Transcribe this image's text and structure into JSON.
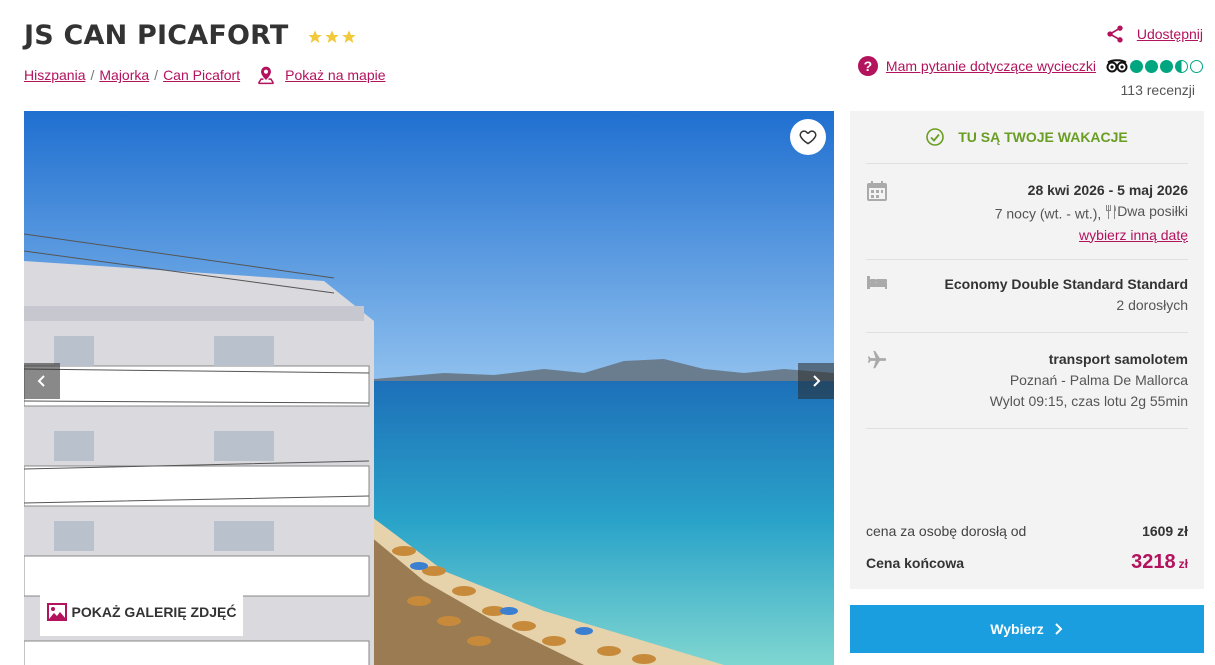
{
  "hotel": {
    "name": "JS CAN PICAFORT",
    "stars": 3
  },
  "breadcrumb": {
    "items": [
      "Hiszpania",
      "Majorka",
      "Can Picafort"
    ],
    "separator": "/",
    "map_link": "Pokaż na mapie"
  },
  "actions": {
    "share_label": "Udostępnij",
    "question_label": "Mam pytanie dotyczące wycieczki",
    "tripadvisor_rating": 3.5,
    "reviews_label": "113 recenzji"
  },
  "gallery": {
    "button_label": "POKAŻ GALERIĘ ZDJĘĆ"
  },
  "offer": {
    "badge": "TU SĄ TWOJE WAKACJE",
    "dates": "28 kwi 2026 - 5 maj 2026",
    "nights": "7 nocy (wt. - wt.),",
    "meals": "Dwa posiłki",
    "change_date": "wybierz inną datę",
    "room": "Economy Double Standard Standard",
    "guests": "2 dorosłych",
    "transport": "transport samolotem",
    "route": "Poznań - Palma De Mallorca",
    "flight": "Wylot 09:15, czas lotu 2g 55min"
  },
  "price": {
    "per_adult_label": "cena za osobę dorosłą od",
    "per_adult_value": "1609 zł",
    "final_label": "Cena końcowa",
    "final_value": "3218",
    "currency": "zł"
  },
  "cta": {
    "label": "Wybierz"
  },
  "colors": {
    "accent": "#b3125d",
    "success": "#6a9e23",
    "button": "#1a9ee0",
    "tripadvisor": "#00a680"
  }
}
